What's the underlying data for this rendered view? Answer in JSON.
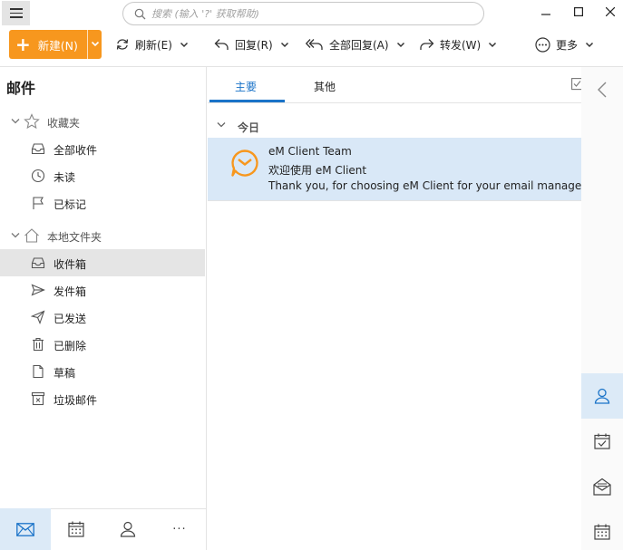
{
  "titlebar": {
    "search_placeholder": "搜索 (输入 '?' 获取帮助)"
  },
  "toolbar": {
    "new_label": "新建(N)",
    "refresh_label": "刷新(E)",
    "reply_label": "回复(R)",
    "reply_all_label": "全部回复(A)",
    "forward_label": "转发(W)",
    "more_label": "更多"
  },
  "sidebar": {
    "title": "邮件",
    "favorites": {
      "label": "收藏夹",
      "items": [
        {
          "label": "全部收件",
          "icon": "inbox-icon"
        },
        {
          "label": "未读",
          "icon": "clock-icon"
        },
        {
          "label": "已标记",
          "icon": "flag-icon"
        }
      ]
    },
    "local": {
      "label": "本地文件夹",
      "items": [
        {
          "label": "收件箱",
          "icon": "inbox-icon",
          "active": true
        },
        {
          "label": "发件箱",
          "icon": "outbox-icon"
        },
        {
          "label": "已发送",
          "icon": "sent-icon"
        },
        {
          "label": "已删除",
          "icon": "trash-icon"
        },
        {
          "label": "草稿",
          "icon": "draft-icon"
        },
        {
          "label": "垃圾邮件",
          "icon": "junk-icon"
        }
      ]
    }
  },
  "bottomnav": {
    "more_label": "···"
  },
  "message_list": {
    "tabs": [
      {
        "label": "主要",
        "active": true
      },
      {
        "label": "其他",
        "active": false
      }
    ],
    "group_label": "今日",
    "messages": [
      {
        "sender": "eM Client Team",
        "subject": "欢迎使用 eM Client",
        "preview": "Thank you, for choosing eM Client for your email management needs"
      }
    ]
  },
  "colors": {
    "accent": "#f7971e",
    "selection": "#d9e8f7",
    "tab_active": "#1a73c8"
  }
}
